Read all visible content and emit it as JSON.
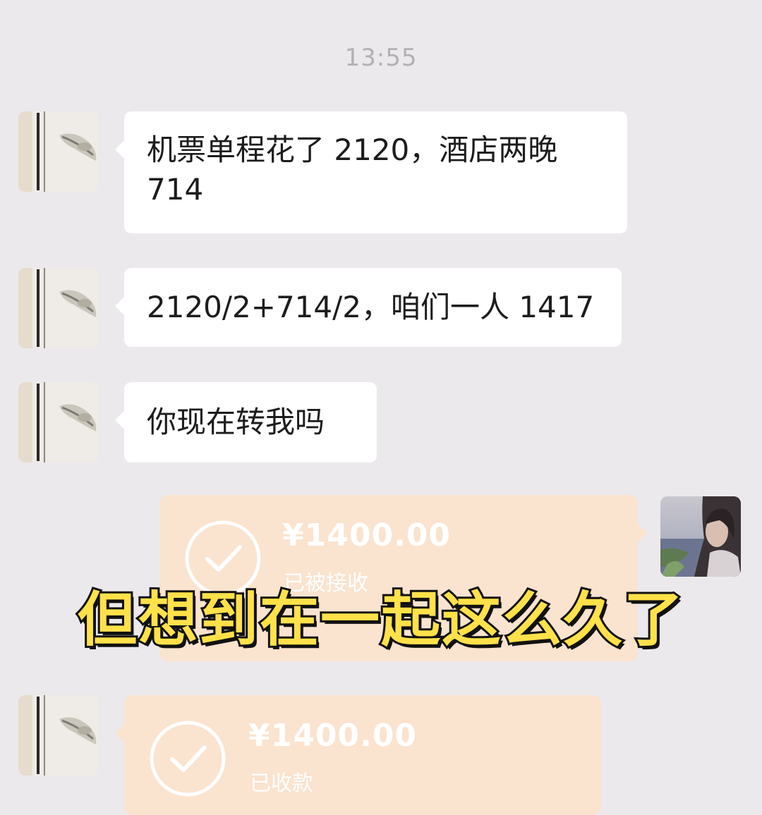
{
  "chat": {
    "timestamp": "13:55",
    "messages": [
      {
        "sender": "contact",
        "type": "text",
        "lines": [
          "机票单程花了 2120，酒店两晚",
          "714"
        ]
      },
      {
        "sender": "contact",
        "type": "text",
        "text": "2120/2+714/2，咱们一人 1417"
      },
      {
        "sender": "contact",
        "type": "text",
        "text": "你现在转我吗"
      },
      {
        "sender": "me",
        "type": "transfer",
        "amount": "¥1400.00",
        "status": "已被接收"
      },
      {
        "sender": "contact",
        "type": "transfer",
        "amount": "¥1400.00",
        "status": "已收款"
      }
    ]
  },
  "overlay": {
    "subtitle": "但想到在一起这么久了"
  },
  "colors": {
    "background": "#ece9ec",
    "bubble": "#ffffff",
    "transfer": "#fae3cf",
    "subtitle_fill": "#ffe14a",
    "subtitle_stroke": "#111111"
  }
}
